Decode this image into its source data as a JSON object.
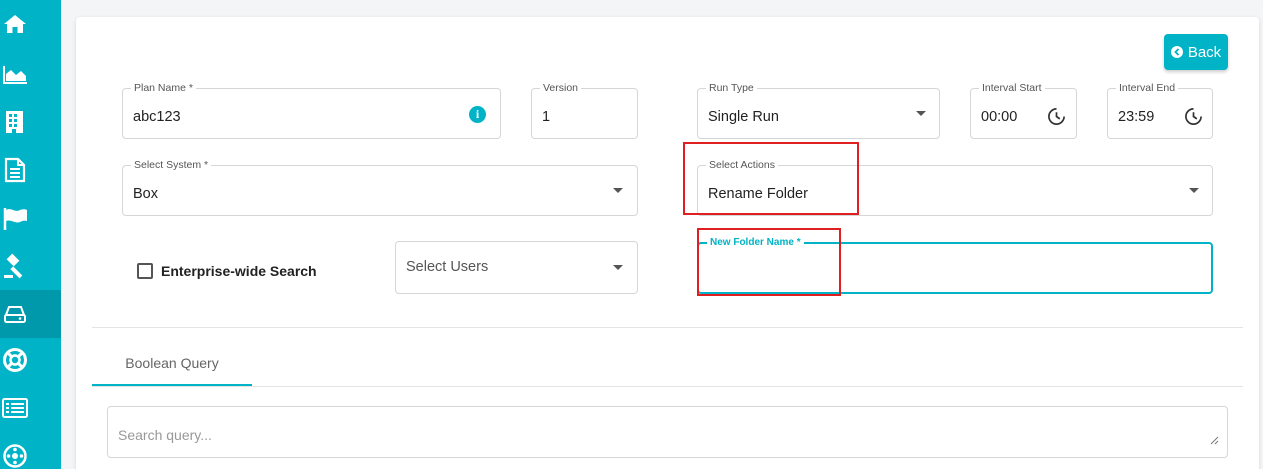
{
  "colors": {
    "accent": "#00b3c6",
    "highlight": "#e02020"
  },
  "sidebar": {
    "items": [
      {
        "icon": "home-icon"
      },
      {
        "icon": "area-chart-icon"
      },
      {
        "icon": "building-icon"
      },
      {
        "icon": "document-icon"
      },
      {
        "icon": "flag-icon"
      },
      {
        "icon": "gavel-icon"
      },
      {
        "icon": "hard-drive-icon",
        "active": true
      },
      {
        "icon": "life-ring-icon"
      },
      {
        "icon": "list-icon"
      },
      {
        "icon": "settings-icon"
      }
    ]
  },
  "header": {
    "back_label": "Back"
  },
  "form": {
    "plan_name": {
      "label": "Plan Name *",
      "value": "abc123"
    },
    "version": {
      "label": "Version",
      "value": "1"
    },
    "run_type": {
      "label": "Run Type",
      "value": "Single Run"
    },
    "interval_start": {
      "label": "Interval Start",
      "value": "00:00"
    },
    "interval_end": {
      "label": "Interval End",
      "value": "23:59"
    },
    "select_system": {
      "label": "Select System *",
      "value": "Box"
    },
    "select_actions": {
      "label": "Select Actions",
      "value": "Rename Folder"
    },
    "enterprise_search": {
      "label": "Enterprise-wide Search",
      "checked": false
    },
    "select_users": {
      "placeholder": "Select Users"
    },
    "new_folder_name": {
      "label": "New Folder Name *",
      "value": ""
    }
  },
  "tabs": [
    {
      "label": "Boolean Query",
      "active": true
    }
  ],
  "query": {
    "placeholder": "Search query..."
  }
}
